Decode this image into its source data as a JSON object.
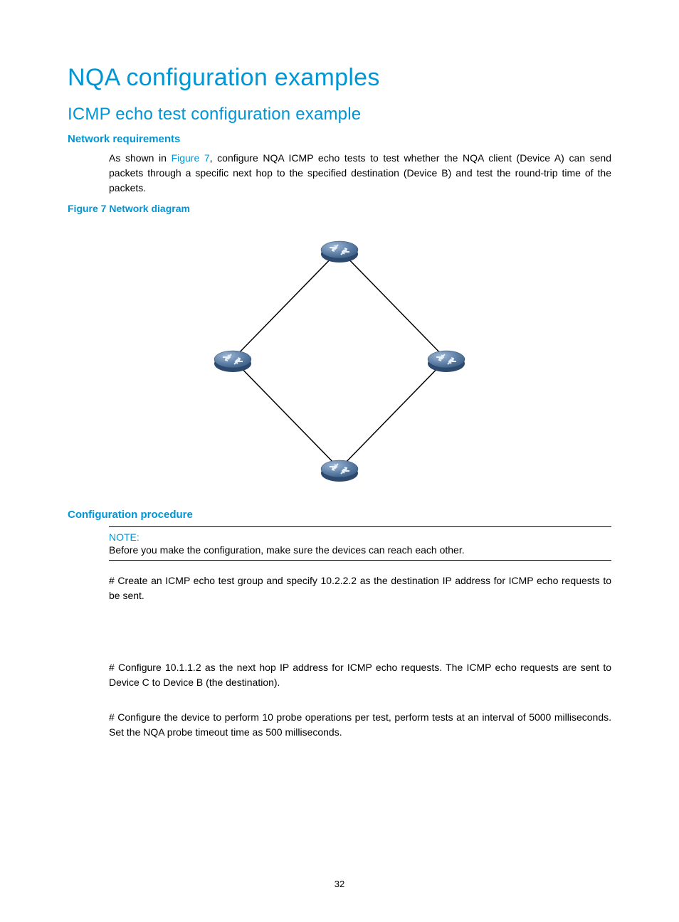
{
  "page": {
    "number": "32"
  },
  "headings": {
    "h1": "NQA configuration examples",
    "h2": "ICMP echo test configuration example",
    "h3a": "Network requirements",
    "figcaption": "Figure 7 Network diagram",
    "h3b": "Configuration procedure"
  },
  "paragraphs": {
    "intro_prefix": "As shown in ",
    "intro_link": "Figure 7",
    "intro_suffix": ", configure NQA ICMP echo tests to test whether the NQA client (Device A) can send packets through a specific next hop to the specified destination (Device B) and test the round-trip time of the packets.",
    "note_label": "NOTE:",
    "note_text": "Before you make the configuration, make sure the devices can reach each other.",
    "step1": "# Create an ICMP echo test group and specify 10.2.2.2 as the destination IP address for ICMP echo requests to be sent.",
    "step2": "# Configure 10.1.1.2 as the next hop IP address for ICMP echo requests. The ICMP echo requests are sent to Device C to Device B (the destination).",
    "step3": "# Configure the device to perform 10 probe operations per test, perform tests at an interval of 5000 milliseconds. Set the NQA probe timeout time as 500 milliseconds."
  },
  "diagram": {
    "nodes": [
      "router-top",
      "router-left",
      "router-right",
      "router-bottom"
    ]
  }
}
